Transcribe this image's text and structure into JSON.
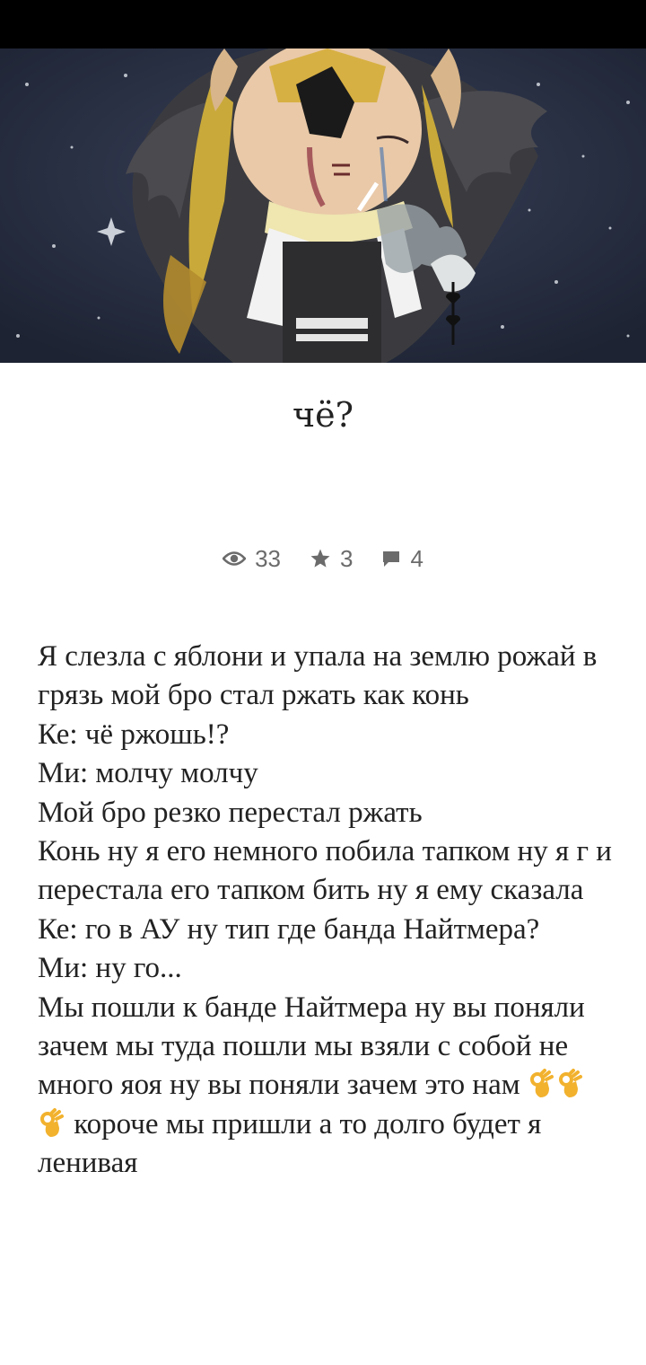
{
  "title": "чё?",
  "stats": {
    "views": "33",
    "stars": "3",
    "comments": "4"
  },
  "story": {
    "lines": [
      "Я слезла с яблони и упала на землю рожай в грязь мой бро стал ржать как конь",
      "Ке: чё ржошь!?",
      "Ми: молчу молчу",
      "Мой бро резко перестал ржать",
      "Конь ну я его немного побила тапком ну я г и перестала его тапком бить ну я ему сказала",
      "Ке: го в АУ ну тип где банда Найтмера?",
      "Ми: ну го...",
      "Мы пошли к банде Найтмера ну вы поняли зачем мы туда пошли мы взяли с собой не много яоя ну вы поняли зачем это нам"
    ],
    "last_line_tail": "короче мы пришли а то долго будет я ленивая"
  },
  "colors": {
    "status_bar": "#000000",
    "cover_bg": "#242b3a",
    "stat_text": "#6b6b6b",
    "body_text": "#222222"
  },
  "icons": [
    "eye-icon",
    "star-icon",
    "comment-icon",
    "ok-hand-icon"
  ]
}
